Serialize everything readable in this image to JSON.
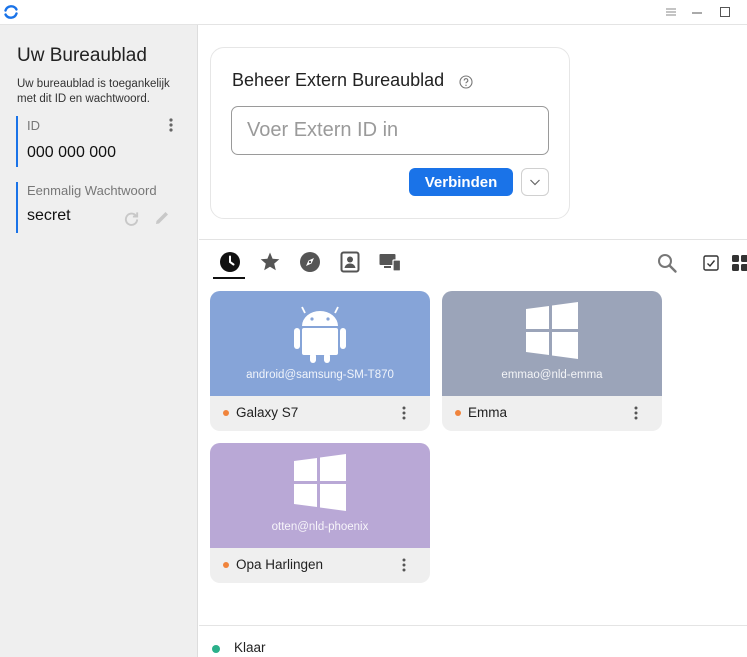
{
  "colors": {
    "accent": "#1a73e8",
    "status_ok": "#2bb08a",
    "peer_offline": "#f0843c"
  },
  "titlebar": {
    "icons": [
      "app-logo-icon",
      "hamburger-icon",
      "minimize-icon",
      "maximize-icon"
    ]
  },
  "sidebar": {
    "title": "Uw Bureaublad",
    "description": "Uw bureaublad is toegankelijk met dit ID en wachtwoord.",
    "id_label": "ID",
    "id_value": "000 000 000",
    "password_label": "Eenmalig Wachtwoord",
    "password_value": "secret"
  },
  "connect": {
    "title": "Beheer Extern Bureaublad",
    "input_placeholder": "Voer Extern ID in",
    "connect_label": "Verbinden"
  },
  "tabs": [
    {
      "name": "recent",
      "icon": "clock-icon",
      "active": true
    },
    {
      "name": "favorites",
      "icon": "star-icon",
      "active": false
    },
    {
      "name": "discovered",
      "icon": "compass-icon",
      "active": false
    },
    {
      "name": "address-book",
      "icon": "contact-card-icon",
      "active": false
    },
    {
      "name": "group",
      "icon": "devices-icon",
      "active": false
    }
  ],
  "peers": [
    {
      "user": "android@samsung-SM-T870",
      "name": "Galaxy S7",
      "os": "android",
      "color": "#86a4d8"
    },
    {
      "user": "emmao@nld-emma",
      "name": "Emma",
      "os": "windows",
      "color": "#9ba4b9"
    },
    {
      "user": "otten@nld-phoenix",
      "name": "Opa Harlingen",
      "os": "windows",
      "color": "#b9a8d6"
    }
  ],
  "status": {
    "text": "Klaar"
  }
}
